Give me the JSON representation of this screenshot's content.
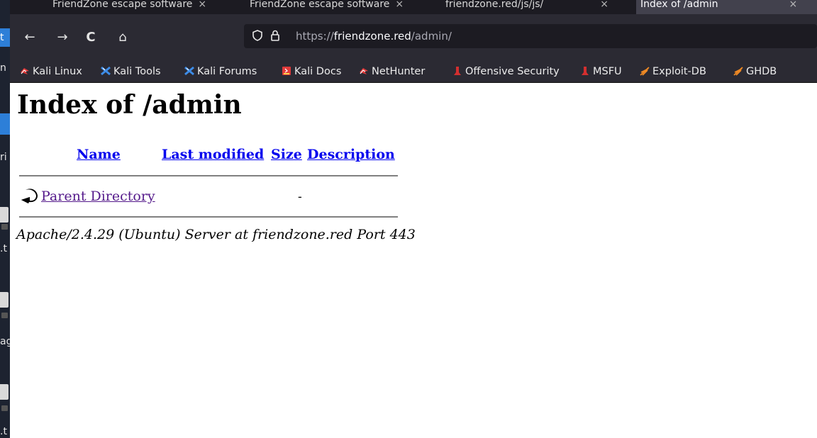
{
  "browser": {
    "tabs": [
      {
        "label": "FriendZone escape software",
        "close": "×",
        "active": false
      },
      {
        "label": "FriendZone escape software",
        "close": "×",
        "active": false
      },
      {
        "label": "friendzone.red/js/js/",
        "close": "×",
        "active": false
      },
      {
        "label": "Index of /admin",
        "close": "×",
        "active": true
      }
    ],
    "nav": {
      "back_icon": "←",
      "forward_icon": "→",
      "reload_icon": "C",
      "home_icon": "⌂"
    },
    "url": {
      "scheme": "https://",
      "host": "friendzone.red",
      "path": "/admin/"
    },
    "bookmarks": [
      {
        "label": "Kali Linux",
        "icon": "kali-dragon-icon",
        "color": "#e03a3a"
      },
      {
        "label": "Kali Tools",
        "icon": "kali-tools-icon",
        "color": "#3d8ce8"
      },
      {
        "label": "Kali Forums",
        "icon": "kali-forums-icon",
        "color": "#3d8ce8"
      },
      {
        "label": "Kali Docs",
        "icon": "kali-docs-icon",
        "color": "#e03a3a"
      },
      {
        "label": "NetHunter",
        "icon": "nethunter-icon",
        "color": "#e03a3a"
      },
      {
        "label": "Offensive Security",
        "icon": "offsec-icon",
        "color": "#d32f2f"
      },
      {
        "label": "MSFU",
        "icon": "msfu-icon",
        "color": "#d32f2f"
      },
      {
        "label": "Exploit-DB",
        "icon": "exploit-db-icon",
        "color": "#f08a24"
      },
      {
        "label": "GHDB",
        "icon": "ghdb-icon",
        "color": "#f08a24"
      }
    ]
  },
  "desktop": {
    "fragments": [
      "n",
      "ri",
      ".t",
      "ag",
      ".t"
    ]
  },
  "page": {
    "title": "Index of /admin",
    "columns": {
      "name": "Name",
      "last_modified": "Last modified",
      "size": "Size",
      "description": "Description"
    },
    "rows": [
      {
        "name": "Parent Directory",
        "last_modified": "",
        "size": "-",
        "description": ""
      }
    ],
    "footer": "Apache/2.4.29 (Ubuntu) Server at friendzone.red Port 443"
  }
}
